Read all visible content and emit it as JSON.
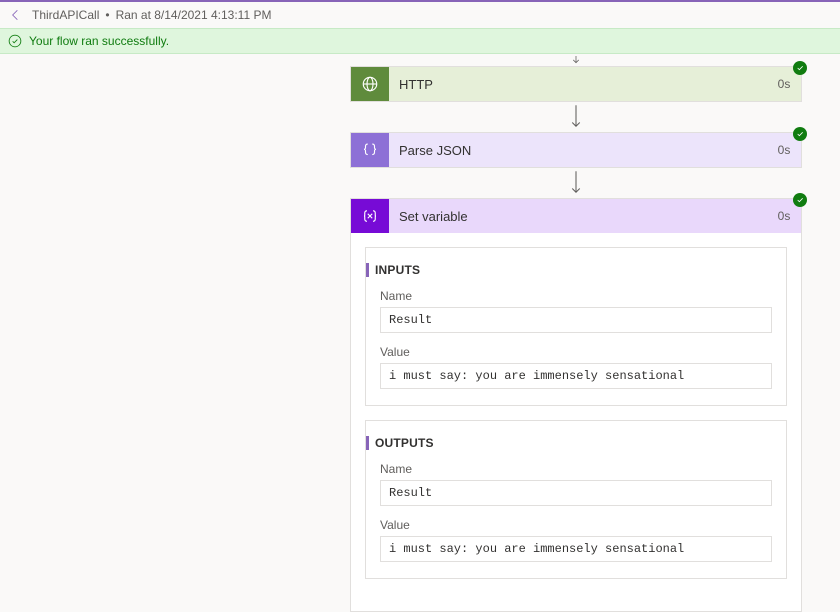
{
  "header": {
    "flow_name": "ThirdAPICall",
    "ran_at_label": "Ran at 8/14/2021 4:13:11 PM"
  },
  "banner": {
    "message": "Your flow ran successfully."
  },
  "steps": {
    "http": {
      "title": "HTTP",
      "duration": "0s"
    },
    "json": {
      "title": "Parse JSON",
      "duration": "0s"
    },
    "var": {
      "title": "Set variable",
      "duration": "0s"
    }
  },
  "var_panel": {
    "inputs": {
      "heading": "INPUTS",
      "name_label": "Name",
      "name_value": "Result",
      "value_label": "Value",
      "value_value": "i must say: you are immensely sensational"
    },
    "outputs": {
      "heading": "OUTPUTS",
      "name_label": "Name",
      "name_value": "Result",
      "value_label": "Value",
      "value_value": "i must say: you are immensely sensational"
    }
  }
}
